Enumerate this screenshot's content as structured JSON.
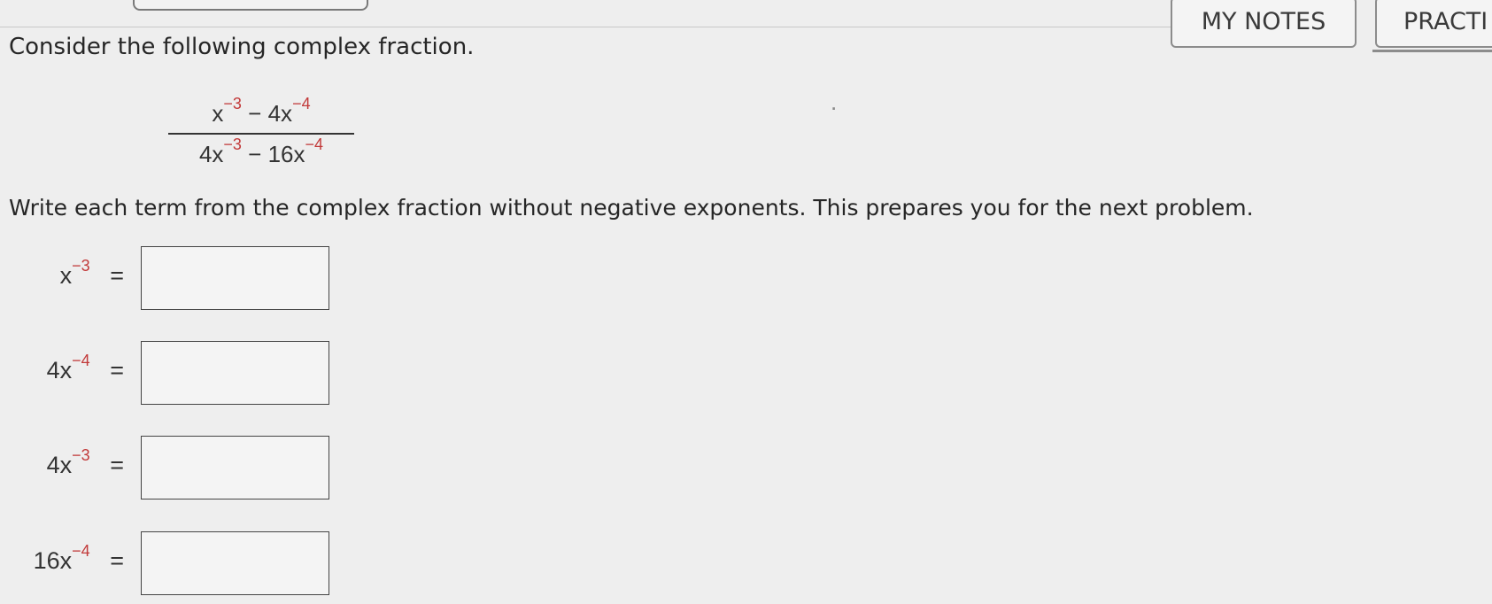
{
  "header": {
    "my_notes_label": "MY NOTES",
    "practice_label": "PRACTI"
  },
  "question": {
    "prompt": "Consider the following complex fraction.",
    "fraction": {
      "numerator": {
        "term1_base": "x",
        "term1_exp": "−3",
        "operator": "−",
        "term2_base": "4x",
        "term2_exp": "−4"
      },
      "denominator": {
        "term1_base": "4x",
        "term1_exp": "−3",
        "operator": "−",
        "term2_base": "16x",
        "term2_exp": "−4"
      },
      "trailing": "."
    },
    "instruction": "Write each term from the complex fraction without negative exponents. This prepares you for the next problem."
  },
  "answers": [
    {
      "base": "x",
      "exponent": "−3",
      "equals": "=",
      "value": ""
    },
    {
      "base": "4x",
      "exponent": "−4",
      "equals": "=",
      "value": ""
    },
    {
      "base": "4x",
      "exponent": "−3",
      "equals": "=",
      "value": ""
    },
    {
      "base": "16x",
      "exponent": "−4",
      "equals": "=",
      "value": ""
    }
  ],
  "colors": {
    "exponent_accent": "#c23a3a",
    "page_background": "#eeeeee"
  }
}
